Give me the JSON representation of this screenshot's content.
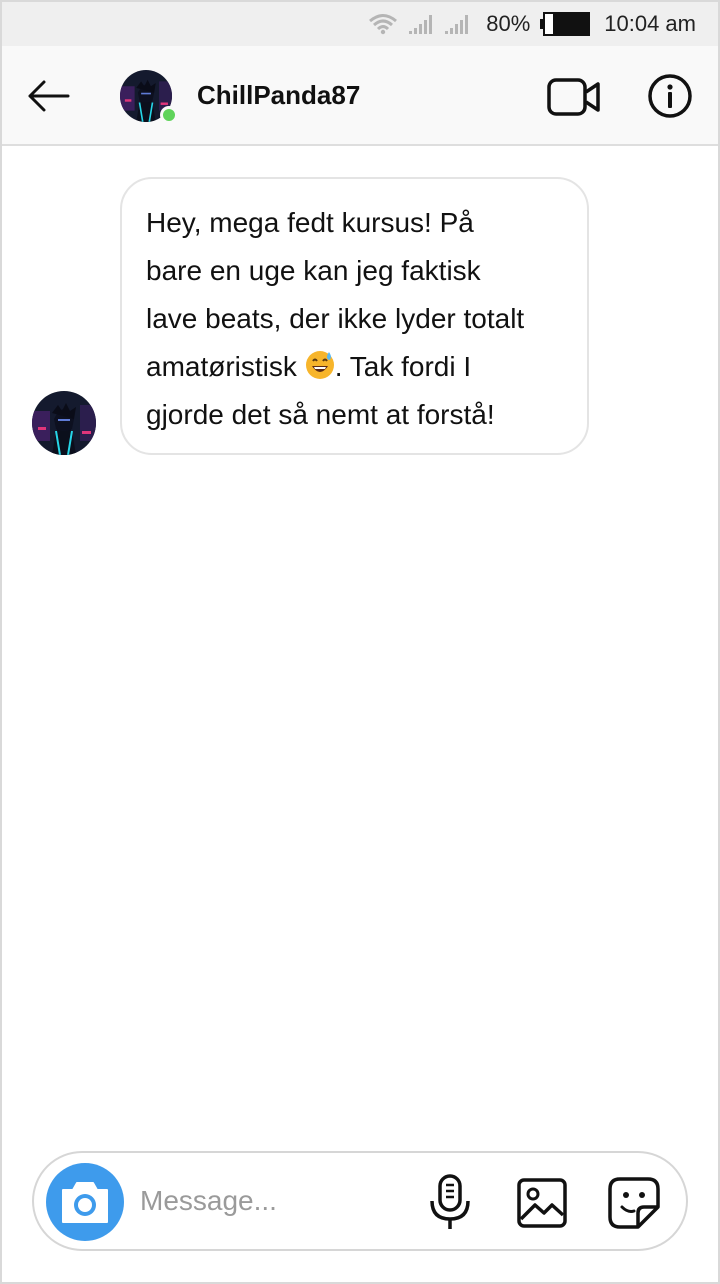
{
  "status_bar": {
    "battery": "80%",
    "time": "10:04 am",
    "icons": [
      "wifi-icon",
      "signal-icon",
      "signal-icon",
      "battery-icon"
    ]
  },
  "header": {
    "username": "ChillPanda87",
    "online": true,
    "icons": [
      "back-arrow-icon",
      "video-call-icon",
      "info-icon"
    ]
  },
  "messages": [
    {
      "sender": "ChillPanda87",
      "lines": [
        "Hey, mega fedt kursus! På",
        "bare en uge kan jeg faktisk",
        "lave beats, der ikke lyder totalt",
        "amatøristisk",
        ". Tak fordi I",
        "gjorde det så nemt at forstå!"
      ],
      "emoji": "grinning-sweat-emoji"
    }
  ],
  "composer": {
    "placeholder": "Message...",
    "value": "",
    "icons": [
      "camera-icon",
      "microphone-icon",
      "gallery-icon",
      "sticker-icon"
    ]
  },
  "colors": {
    "online": "#5fd35a",
    "camera_button": "#3e9bec",
    "status_bar_bg": "#efefef",
    "header_bg": "#f9f9f9"
  }
}
